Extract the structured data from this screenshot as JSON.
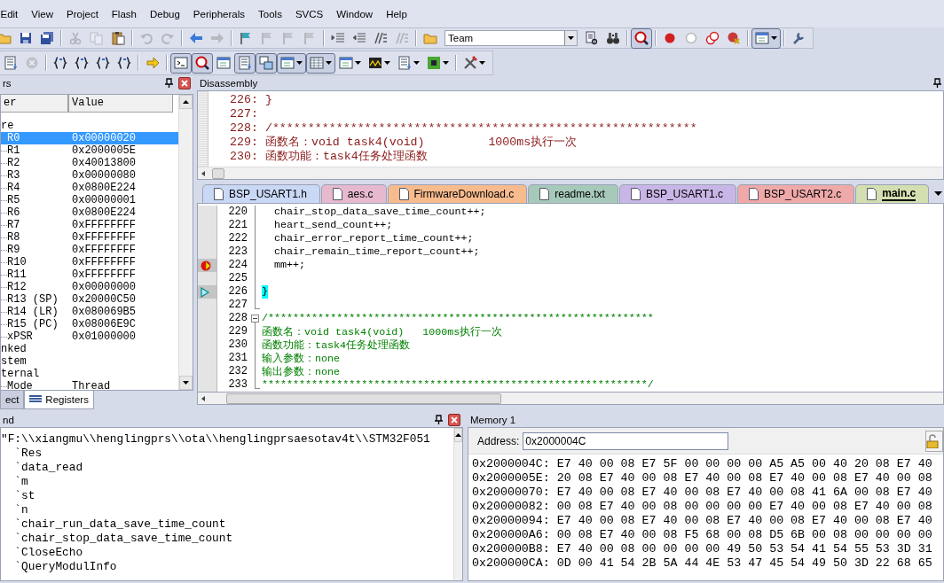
{
  "menu": [
    "Edit",
    "View",
    "Project",
    "Flash",
    "Debug",
    "Peripherals",
    "Tools",
    "SVCS",
    "Window",
    "Help"
  ],
  "toolbar_1": [
    [
      {
        "kind": "button",
        "pressed": false,
        "disabled": false,
        "dropdown": false
      },
      {
        "kind": "button",
        "pressed": false,
        "disabled": false,
        "dropdown": false
      },
      {
        "kind": "button",
        "pressed": false,
        "disabled": false,
        "dropdown": false
      }
    ],
    [
      {
        "kind": "button",
        "pressed": false,
        "disabled": true,
        "dropdown": false
      },
      {
        "kind": "button",
        "pressed": false,
        "disabled": true,
        "dropdown": false
      },
      {
        "kind": "button",
        "pressed": false,
        "disabled": false,
        "dropdown": false
      }
    ],
    [
      {
        "kind": "button",
        "pressed": false,
        "disabled": true,
        "dropdown": false
      },
      {
        "kind": "button",
        "pressed": false,
        "disabled": true,
        "dropdown": false
      }
    ],
    [
      {
        "kind": "button",
        "pressed": false,
        "disabled": false,
        "dropdown": false
      },
      {
        "kind": "button",
        "pressed": false,
        "disabled": true,
        "dropdown": false
      }
    ],
    [
      {
        "kind": "button",
        "pressed": false,
        "disabled": false,
        "dropdown": false
      },
      {
        "kind": "button",
        "pressed": false,
        "disabled": true,
        "dropdown": false
      },
      {
        "kind": "button",
        "pressed": false,
        "disabled": true,
        "dropdown": false
      },
      {
        "kind": "button",
        "pressed": false,
        "disabled": true,
        "dropdown": false
      }
    ],
    [
      {
        "kind": "button",
        "pressed": false,
        "disabled": false,
        "dropdown": false
      },
      {
        "kind": "button",
        "pressed": false,
        "disabled": false,
        "dropdown": false
      },
      {
        "kind": "button",
        "pressed": false,
        "disabled": false,
        "dropdown": false
      },
      {
        "kind": "button",
        "pressed": false,
        "disabled": true,
        "dropdown": false
      }
    ],
    [
      {
        "kind": "button",
        "pressed": false,
        "disabled": false,
        "dropdown": false
      },
      {
        "kind": "combo",
        "value": "Team"
      },
      {
        "kind": "button",
        "pressed": false,
        "disabled": false,
        "dropdown": false
      },
      {
        "kind": "button",
        "pressed": false,
        "disabled": false,
        "dropdown": false
      }
    ],
    [
      {
        "kind": "button",
        "pressed": true,
        "disabled": false,
        "dropdown": false
      }
    ],
    [
      {
        "kind": "button",
        "pressed": false,
        "disabled": false,
        "dropdown": false
      },
      {
        "kind": "button",
        "pressed": false,
        "disabled": false,
        "dropdown": false
      },
      {
        "kind": "button",
        "pressed": false,
        "disabled": false,
        "dropdown": false
      },
      {
        "kind": "button",
        "pressed": false,
        "disabled": false,
        "dropdown": false
      }
    ],
    [
      {
        "kind": "button",
        "pressed": true,
        "disabled": false,
        "dropdown": true
      }
    ],
    [
      {
        "kind": "button",
        "pressed": false,
        "disabled": false,
        "dropdown": false
      }
    ]
  ],
  "toolbar_2": [
    [
      {
        "pressed": false,
        "disabled": false,
        "dropdown": false
      },
      {
        "pressed": false,
        "disabled": true,
        "dropdown": false
      }
    ],
    [
      {
        "pressed": false,
        "disabled": false,
        "dropdown": false
      },
      {
        "pressed": false,
        "disabled": false,
        "dropdown": false
      },
      {
        "pressed": false,
        "disabled": false,
        "dropdown": false
      },
      {
        "pressed": false,
        "disabled": false,
        "dropdown": false
      }
    ],
    [
      {
        "pressed": false,
        "disabled": false,
        "dropdown": false
      }
    ],
    [
      {
        "pressed": true,
        "disabled": false,
        "dropdown": false
      },
      {
        "pressed": true,
        "disabled": false,
        "dropdown": false
      },
      {
        "pressed": false,
        "disabled": false,
        "dropdown": false
      },
      {
        "pressed": true,
        "disabled": false,
        "dropdown": false
      },
      {
        "pressed": true,
        "disabled": false,
        "dropdown": false
      },
      {
        "pressed": true,
        "disabled": false,
        "dropdown": true
      },
      {
        "pressed": true,
        "disabled": false,
        "dropdown": true
      },
      {
        "pressed": false,
        "disabled": false,
        "dropdown": true
      },
      {
        "pressed": false,
        "disabled": false,
        "dropdown": true
      },
      {
        "pressed": false,
        "disabled": false,
        "dropdown": true
      },
      {
        "pressed": false,
        "disabled": false,
        "dropdown": true
      }
    ],
    [
      {
        "pressed": false,
        "disabled": false,
        "dropdown": true
      }
    ]
  ],
  "registers": {
    "title": "rs",
    "columns": [
      "er",
      "Value"
    ],
    "tree": [
      {
        "name": "re",
        "selected": false,
        "children": [
          {
            "name": "R0",
            "value": "0x00000020",
            "selected": true
          },
          {
            "name": "R1",
            "value": "0x2000005E",
            "selected": false
          },
          {
            "name": "R2",
            "value": "0x40013800",
            "selected": false
          },
          {
            "name": "R3",
            "value": "0x00000080",
            "selected": false
          },
          {
            "name": "R4",
            "value": "0x0800E224",
            "selected": false
          },
          {
            "name": "R5",
            "value": "0x00000001",
            "selected": false
          },
          {
            "name": "R6",
            "value": "0x0800E224",
            "selected": false
          },
          {
            "name": "R7",
            "value": "0xFFFFFFFF",
            "selected": false
          },
          {
            "name": "R8",
            "value": "0xFFFFFFFF",
            "selected": false
          },
          {
            "name": "R9",
            "value": "0xFFFFFFFF",
            "selected": false
          },
          {
            "name": "R10",
            "value": "0xFFFFFFFF",
            "selected": false
          },
          {
            "name": "R11",
            "value": "0xFFFFFFFF",
            "selected": false
          },
          {
            "name": "R12",
            "value": "0x00000000",
            "selected": false
          },
          {
            "name": "R13 (SP)",
            "value": "0x20000C50",
            "selected": false
          },
          {
            "name": "R14 (LR)",
            "value": "0x080069B5",
            "selected": false
          },
          {
            "name": "R15 (PC)",
            "value": "0x08006E9C",
            "selected": false
          },
          {
            "name": "xPSR",
            "value": "0x01000000",
            "selected": false
          }
        ]
      },
      {
        "name": "nked",
        "selected": false
      },
      {
        "name": "stem",
        "selected": false
      },
      {
        "name": "ternal",
        "selected": false,
        "children": [
          {
            "name": "Mode",
            "value": "Thread",
            "selected": false
          }
        ]
      }
    ],
    "tabs": [
      {
        "label": "ect",
        "selected": false
      },
      {
        "label": "Registers",
        "selected": true
      }
    ]
  },
  "disassembly": {
    "title": "Disassembly",
    "lines": [
      "226: }",
      "227:",
      "228: /************************************************************",
      "229: 函数名：void task4(void)         1000ms执行一次",
      "230: 函数功能：task4任务处理函数"
    ]
  },
  "editor": {
    "tabs": [
      {
        "label": "BSP_USART1.h",
        "color": "#c9d8f5",
        "selected": false
      },
      {
        "label": "aes.c",
        "color": "#e6b9cf",
        "selected": false
      },
      {
        "label": "FirmwareDownload.c",
        "color": "#f7bb8e",
        "selected": false
      },
      {
        "label": "readme.txt",
        "color": "#a6c9ba",
        "selected": false
      },
      {
        "label": "BSP_USART1.c",
        "color": "#c8b6e6",
        "selected": false
      },
      {
        "label": "BSP_USART2.c",
        "color": "#f0a9a9",
        "selected": false
      },
      {
        "label": "main.c",
        "color": "#d3dfb0",
        "selected": true
      }
    ],
    "lines": [
      {
        "number": "220",
        "text": "  chair_stop_data_save_time_count++;",
        "kind": "code",
        "fold_start": false,
        "fold_end": false,
        "breakpoint": false,
        "pc": false,
        "caller": false
      },
      {
        "number": "221",
        "text": "  heart_send_count++;",
        "kind": "code",
        "fold_start": false,
        "fold_end": false,
        "breakpoint": false,
        "pc": false,
        "caller": false
      },
      {
        "number": "222",
        "text": "  chair_error_report_time_count++;",
        "kind": "code",
        "fold_start": false,
        "fold_end": false,
        "breakpoint": false,
        "pc": false,
        "caller": false
      },
      {
        "number": "223",
        "text": "  chair_remain_time_report_count++;",
        "kind": "code",
        "fold_start": false,
        "fold_end": false,
        "breakpoint": false,
        "pc": false,
        "caller": false
      },
      {
        "number": "224",
        "text": "  mm++;",
        "kind": "code",
        "fold_start": false,
        "fold_end": false,
        "breakpoint": true,
        "pc": true,
        "caller": false
      },
      {
        "number": "225",
        "fold_start": false,
        "fold_end": false,
        "breakpoint": false,
        "pc": false,
        "caller": false
      },
      {
        "number": "226",
        "text": "}",
        "kind": "code",
        "fold_start": false,
        "fold_end": false,
        "breakpoint": false,
        "pc": false,
        "caller": true
      },
      {
        "number": "227",
        "fold_start": false,
        "fold_end": true,
        "breakpoint": false,
        "pc": false,
        "caller": false
      },
      {
        "number": "228",
        "text": "/**************************************************************",
        "kind": "comment",
        "fold_start": true,
        "fold_end": false,
        "breakpoint": false,
        "pc": false,
        "caller": false
      },
      {
        "number": "229",
        "text": "函数名：void task4(void)   1000ms执行一次",
        "kind": "comment",
        "fold_start": false,
        "fold_end": false,
        "breakpoint": false,
        "pc": false,
        "caller": false
      },
      {
        "number": "230",
        "text": "函数功能：task4任务处理函数",
        "kind": "comment",
        "fold_start": false,
        "fold_end": false,
        "breakpoint": false,
        "pc": false,
        "caller": false
      },
      {
        "number": "231",
        "text": "输入参数：none",
        "kind": "comment",
        "fold_start": false,
        "fold_end": false,
        "breakpoint": false,
        "pc": false,
        "caller": false
      },
      {
        "number": "232",
        "text": "输出参数：none",
        "kind": "comment",
        "fold_start": false,
        "fold_end": false,
        "breakpoint": false,
        "pc": false,
        "caller": false
      },
      {
        "number": "233",
        "text": "**************************************************************/",
        "kind": "comment",
        "fold_start": false,
        "fold_end": true,
        "breakpoint": false,
        "pc": false,
        "caller": false
      }
    ]
  },
  "command": {
    "title": "nd",
    "lines": [
      "\"F:\\\\xiangmu\\\\henglingprs\\\\ota\\\\henglingprsaesotav4t\\\\STM32F051",
      "  `Res",
      "  `data_read",
      "  `m",
      "  `st",
      "  `n",
      "  `chair_run_data_save_time_count",
      "  `chair_stop_data_save_time_count",
      "  `CloseEcho",
      "  `QueryModulInfo"
    ]
  },
  "memory": {
    "title": "Memory 1",
    "address_label": "Address:",
    "address": "0x2000004C",
    "rows": [
      {
        "address": "0x2000004C:",
        "bytes": "E7 40 00 08 E7 5F 00 00 00 00 A5 A5 00 40 20 08 E7 40"
      },
      {
        "address": "0x2000005E:",
        "bytes": "20 08 E7 40 00 08 E7 40 00 08 E7 40 00 08 E7 40 00 08"
      },
      {
        "address": "0x20000070:",
        "bytes": "E7 40 00 08 E7 40 00 08 E7 40 00 08 41 6A 00 08 E7 40"
      },
      {
        "address": "0x20000082:",
        "bytes": "00 08 E7 40 00 08 00 00 00 00 E7 40 00 08 E7 40 00 08"
      },
      {
        "address": "0x20000094:",
        "bytes": "E7 40 00 08 E7 40 00 08 E7 40 00 08 E7 40 00 08 E7 40"
      },
      {
        "address": "0x200000A6:",
        "bytes": "00 08 E7 40 00 08 F5 68 00 08 D5 6B 00 08 00 00 00 00"
      },
      {
        "address": "0x200000B8:",
        "bytes": "E7 40 00 08 00 00 00 00 49 50 53 54 41 54 55 53 3D 31"
      },
      {
        "address": "0x200000CA:",
        "bytes": "0D 00 41 54 2B 5A 44 4E 53 47 45 54 49 50 3D 22 68 65"
      }
    ]
  }
}
